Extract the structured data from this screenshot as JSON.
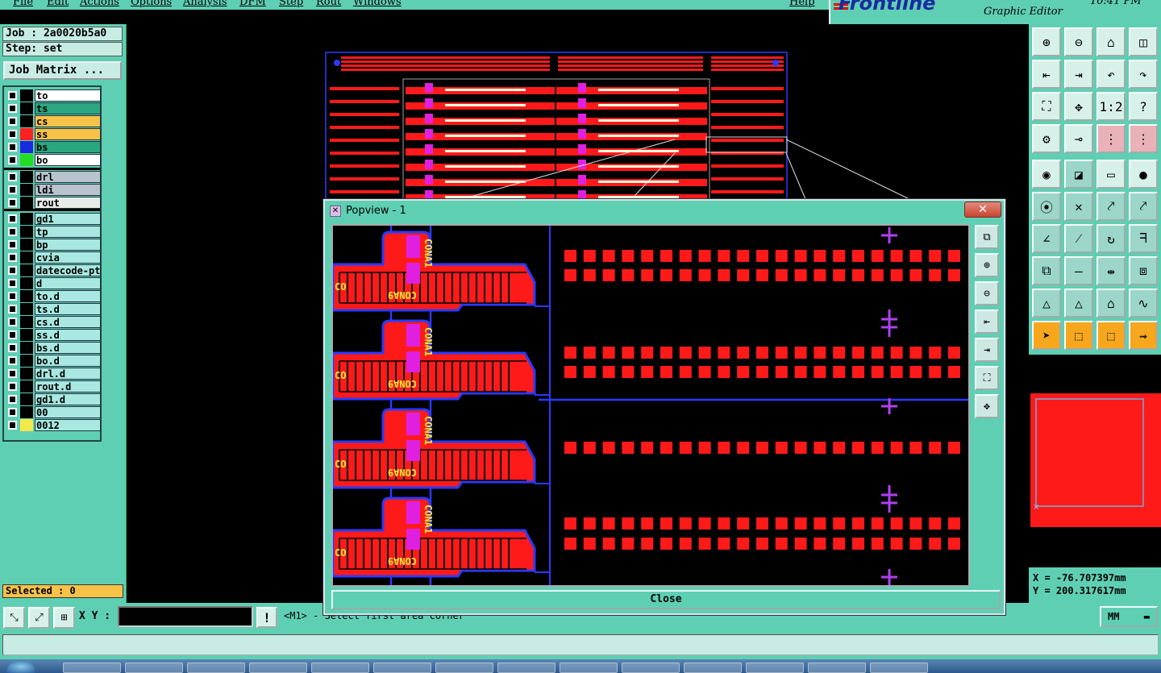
{
  "menu": [
    "File",
    "Edit",
    "Actions",
    "Options",
    "Analysis",
    "DFM",
    "Step",
    "Rout",
    "Windows"
  ],
  "help_label": "Help",
  "brand": {
    "logo": "Frontline",
    "subtitle": "Graphic Editor",
    "clock": "10:41 PM"
  },
  "job": {
    "job_label": "Job : 2a0020b5a0",
    "step_label": "Step: set",
    "matrix_button": "Job Matrix ..."
  },
  "layers": [
    {
      "name": "to",
      "color": "#ffffff",
      "swatch": "#000000"
    },
    {
      "name": "ts",
      "color": "#2aa77e",
      "swatch": "#000000"
    },
    {
      "name": "cs",
      "color": "#f6c247",
      "swatch": "#000000"
    },
    {
      "name": "ss",
      "color": "#f6c247",
      "swatch": "#ff2020"
    },
    {
      "name": "bs",
      "color": "#2aa77e",
      "swatch": "#1a2adf"
    },
    {
      "name": "bo",
      "color": "#ffffff",
      "swatch": "#22dd22"
    },
    {
      "name": "drl",
      "color": "#b9c3cd",
      "swatch": "#000000"
    },
    {
      "name": "ldi",
      "color": "#b9c3cd",
      "swatch": "#000000"
    },
    {
      "name": "rout",
      "color": "#e8ece8",
      "swatch": "#000000"
    },
    {
      "name": "gd1",
      "color": "#a8e8e0",
      "swatch": "#000000"
    },
    {
      "name": "tp",
      "color": "#a8e8e0",
      "swatch": "#000000"
    },
    {
      "name": "bp",
      "color": "#a8e8e0",
      "swatch": "#000000"
    },
    {
      "name": "cvia",
      "color": "#a8e8e0",
      "swatch": "#000000"
    },
    {
      "name": "datecode-pte",
      "color": "#a8e8e0",
      "swatch": "#000000"
    },
    {
      "name": "d",
      "color": "#a8e8e0",
      "swatch": "#000000"
    },
    {
      "name": "to.d",
      "color": "#a8e8e0",
      "swatch": "#000000"
    },
    {
      "name": "ts.d",
      "color": "#a8e8e0",
      "swatch": "#000000"
    },
    {
      "name": "cs.d",
      "color": "#a8e8e0",
      "swatch": "#000000"
    },
    {
      "name": "ss.d",
      "color": "#a8e8e0",
      "swatch": "#000000"
    },
    {
      "name": "bs.d",
      "color": "#a8e8e0",
      "swatch": "#000000"
    },
    {
      "name": "bo.d",
      "color": "#a8e8e0",
      "swatch": "#000000"
    },
    {
      "name": "drl.d",
      "color": "#a8e8e0",
      "swatch": "#000000"
    },
    {
      "name": "rout.d",
      "color": "#a8e8e0",
      "swatch": "#000000"
    },
    {
      "name": "gd1.d",
      "color": "#a8e8e0",
      "swatch": "#000000"
    },
    {
      "name": "00",
      "color": "#a8e8e0",
      "swatch": "#000000"
    },
    {
      "name": "0012",
      "color": "#a8e8e0",
      "swatch": "#f4e84a"
    }
  ],
  "selected_label": "Selected : 0",
  "xy_label": "X Y :",
  "xy_value": "",
  "prompt_text": "<M1> - Select first area corner",
  "units": "MM",
  "coords": {
    "x": "X = -76.707397mm",
    "y": "Y = 200.317617mm"
  },
  "popview": {
    "title": "Popview - 1",
    "close_label": "Close",
    "close_x": "✕",
    "pcb_label": "CONA9",
    "pcb_label2": "CONA1"
  },
  "colors": {
    "accent": "#5fcfb4",
    "copper": "#ff1a1a",
    "outline": "#2a3aff",
    "silk": "#ffee33",
    "magenta": "#e020e0",
    "purple": "#b040f0"
  }
}
